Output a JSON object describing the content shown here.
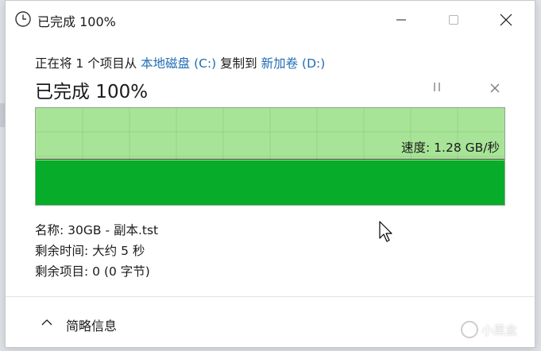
{
  "window": {
    "title": "已完成 100%"
  },
  "transfer": {
    "prefix": "正在将 1 个项目从 ",
    "source": "本地磁盘 (C:)",
    "middle": " 复制到 ",
    "destination": "新加卷 (D:)",
    "status": "已完成 100%",
    "progress_percent": 100
  },
  "graph": {
    "speed_label": "速度: 1.28 GB/秒",
    "fill_color": "#06ac2a",
    "background_color": "#a8e498"
  },
  "details": {
    "name_label": "名称: ",
    "name_value": "30GB - 副本.tst",
    "time_label": "剩余时间: ",
    "time_value": "大约 5 秒",
    "items_label": "剩余项目: ",
    "items_value": "0 (0 字节)"
  },
  "footer": {
    "toggle_label": "简略信息"
  },
  "watermark": {
    "text": "小黑盒"
  },
  "icons": {
    "title": "clock-icon",
    "minimize": "minimize-icon",
    "maximize": "maximize-icon",
    "close": "close-icon",
    "pause": "pause-icon",
    "cancel": "cancel-icon",
    "toggle": "chevron-up-icon"
  }
}
